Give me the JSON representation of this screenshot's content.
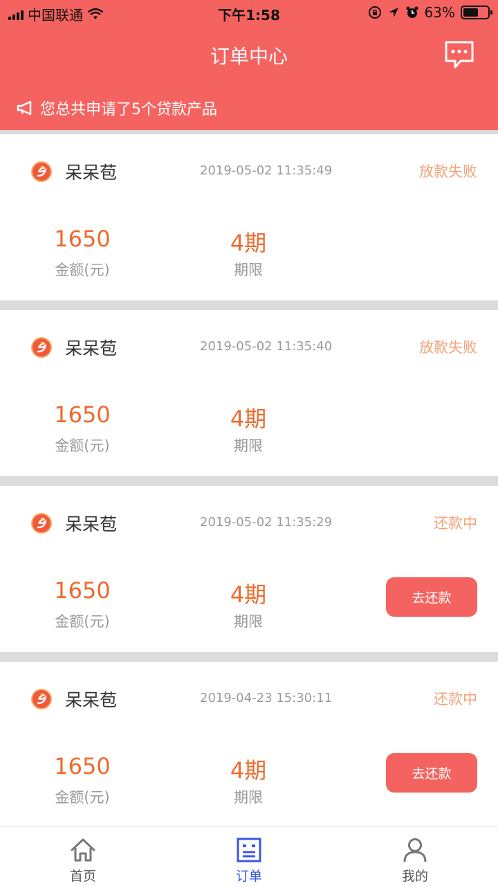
{
  "status_bar": {
    "carrier": "中国联通",
    "time": "下午1:58",
    "battery": "63%",
    "battery_level": 0.63
  },
  "header": {
    "title": "订单中心",
    "message_icon": "chat-bubble-icon",
    "notice": "您总共申请了5个贷款产品",
    "notice_icon": "megaphone-icon"
  },
  "colors": {
    "brand": "#f56360",
    "amount": "#ee6a2c",
    "status": "#f5a27a",
    "active_tab": "#3b55e6"
  },
  "orders": [
    {
      "product": "呆呆苞",
      "time": "2019-05-02 11:35:49",
      "status": "放款失败",
      "amount": "1650",
      "amount_label": "金额(元)",
      "term": "4期",
      "term_label": "期限",
      "button": ""
    },
    {
      "product": "呆呆苞",
      "time": "2019-05-02 11:35:40",
      "status": "放款失败",
      "amount": "1650",
      "amount_label": "金额(元)",
      "term": "4期",
      "term_label": "期限",
      "button": ""
    },
    {
      "product": "呆呆苞",
      "time": "2019-05-02 11:35:29",
      "status": "还款中",
      "amount": "1650",
      "amount_label": "金额(元)",
      "term": "4期",
      "term_label": "期限",
      "button": "去还款"
    },
    {
      "product": "呆呆苞",
      "time": "2019-04-23 15:30:11",
      "status": "还款中",
      "amount": "1650",
      "amount_label": "金额(元)",
      "term": "4期",
      "term_label": "期限",
      "button": "去还款"
    }
  ],
  "tabs": [
    {
      "label": "首页",
      "icon": "home-icon",
      "active": false
    },
    {
      "label": "订单",
      "icon": "order-list-icon",
      "active": true
    },
    {
      "label": "我的",
      "icon": "user-icon",
      "active": false
    }
  ]
}
